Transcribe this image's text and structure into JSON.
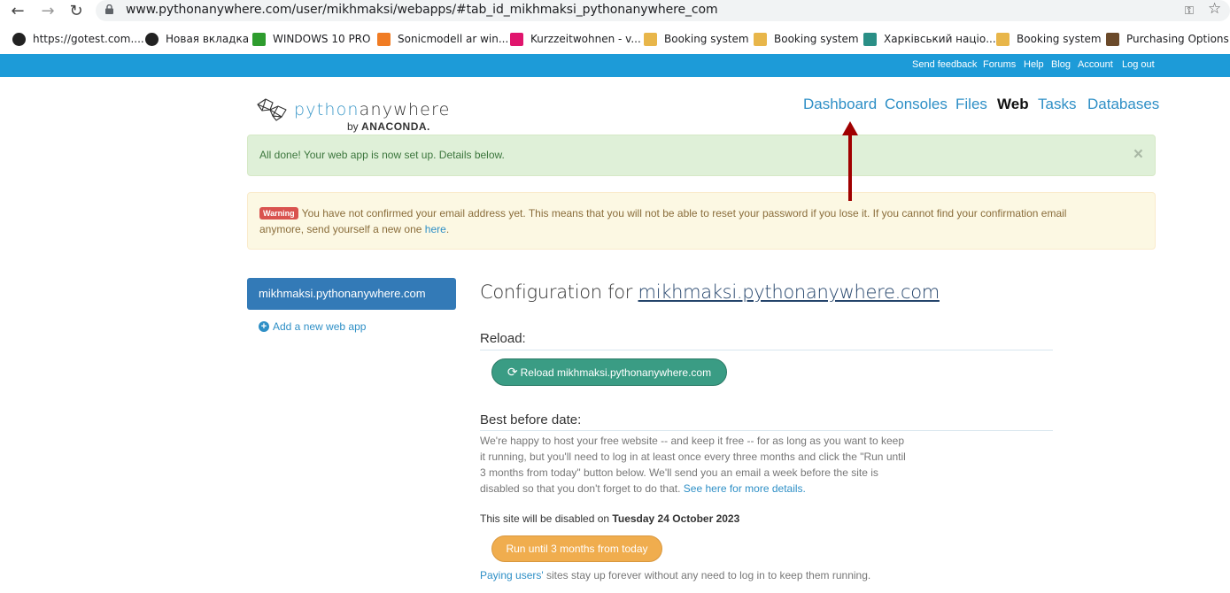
{
  "browser": {
    "url": "www.pythonanywhere.com/user/mikhmaksi/webapps/#tab_id_mikhmaksi_pythonanywhere_com",
    "bookmarks": [
      {
        "label": "https://gotest.com....",
        "icon": "github-icon",
        "color": "#222222"
      },
      {
        "label": "Новая вкладка",
        "icon": "globe-icon",
        "color": "#222222"
      },
      {
        "label": "WINDOWS 10 PRO",
        "icon": "windows-icon",
        "color": "#2e9c2e"
      },
      {
        "label": "Sonicmodell ar win...",
        "icon": "bg-icon",
        "color": "#f07c24"
      },
      {
        "label": "Kurzzeitwohnen - v...",
        "icon": "kurz-icon",
        "color": "#e0156d"
      },
      {
        "label": "Booking system",
        "icon": "booking-icon",
        "color": "#e8b64a"
      },
      {
        "label": "Booking system",
        "icon": "booking-icon",
        "color": "#e8b64a"
      },
      {
        "label": "Харківський націо...",
        "icon": "university-icon",
        "color": "#2a8f86"
      },
      {
        "label": "Booking system",
        "icon": "booking-icon",
        "color": "#e8b64a"
      },
      {
        "label": "Purchasing Options...",
        "icon": "box-icon",
        "color": "#6b4a2a"
      }
    ]
  },
  "topbar": {
    "links": [
      "Send feedback",
      "Forums",
      "Help",
      "Blog",
      "Account",
      "Log out"
    ]
  },
  "logo": {
    "word_part1": "python",
    "word_part2": "anywhere",
    "by": "by",
    "brand": "ANACONDA."
  },
  "nav": [
    "Dashboard",
    "Consoles",
    "Files",
    "Web",
    "Tasks",
    "Databases"
  ],
  "alerts": {
    "success": "All done! Your web app is now set up. Details below.",
    "close": "×",
    "warning_badge": "Warning",
    "warning_line1": "You have not confirmed your email address yet. This means that you will not be able to reset your password if you lose it. If you cannot find your confirmation email",
    "warning_line2": "anymore, send yourself a new one",
    "warning_link": "here",
    "warning_end": "."
  },
  "sidebar": {
    "active_app": "mikhmaksi.pythonanywhere.com",
    "add_new": "Add a new web app"
  },
  "main": {
    "config_prefix": "Configuration for",
    "config_domain": "mikhmaksi.pythonanywhere.com",
    "reload_heading": "Reload:",
    "reload_button": "Reload mikhmaksi.pythonanywhere.com",
    "best_before_heading": "Best before date:",
    "para1": "We're happy to host your free website -- and keep it free -- for as long as you want to keep",
    "para2": "it running, but you'll need to log in at least once every three months and click the \"Run until",
    "para3": "3 months from today\" button below. We'll send you an email a week before the site is",
    "para4": "disabled so that you don't forget to do that.",
    "para4_link": "See here for more details.",
    "disabled_prefix": "This site will be disabled on",
    "disabled_date": "Tuesday 24 October 2023",
    "run_button": "Run until 3 months from today",
    "paying_link": "Paying users'",
    "paying_rest": " sites stay up forever without any need to log in to keep them running."
  },
  "colors": {
    "topbar": "#1d9bd8",
    "link": "#2e8fc6",
    "reload_button": "#3a9c84",
    "run_button": "#f0ad4e",
    "annotation_arrow": "#a00000"
  }
}
